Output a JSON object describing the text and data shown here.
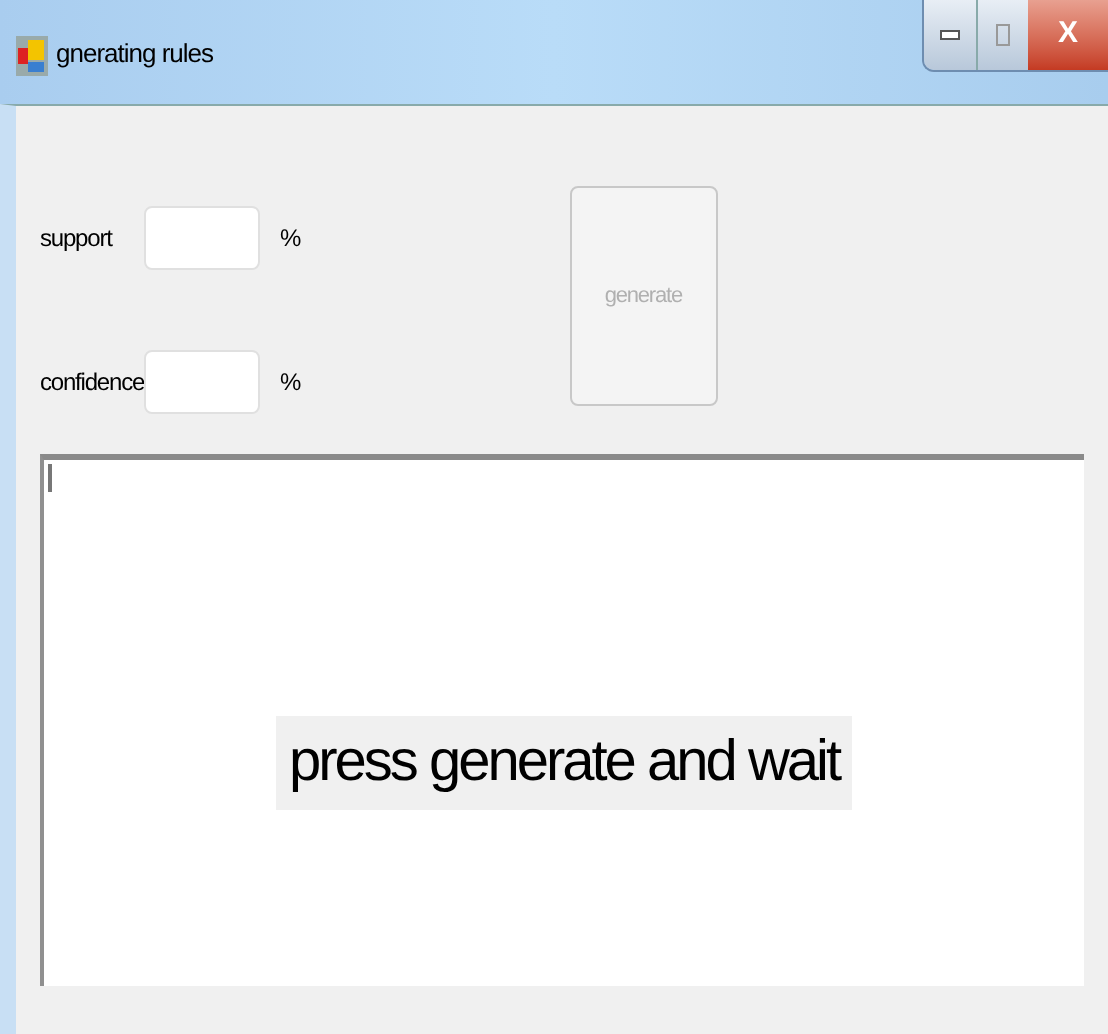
{
  "window": {
    "title": "gnerating rules",
    "close": "X"
  },
  "fields": [
    {
      "label": "support",
      "unit": "%"
    },
    {
      "label": "confidence",
      "unit": "%"
    }
  ],
  "generate_button": {
    "label": "generate",
    "disabled": true
  },
  "output": {
    "status": "press generate and wait"
  }
}
